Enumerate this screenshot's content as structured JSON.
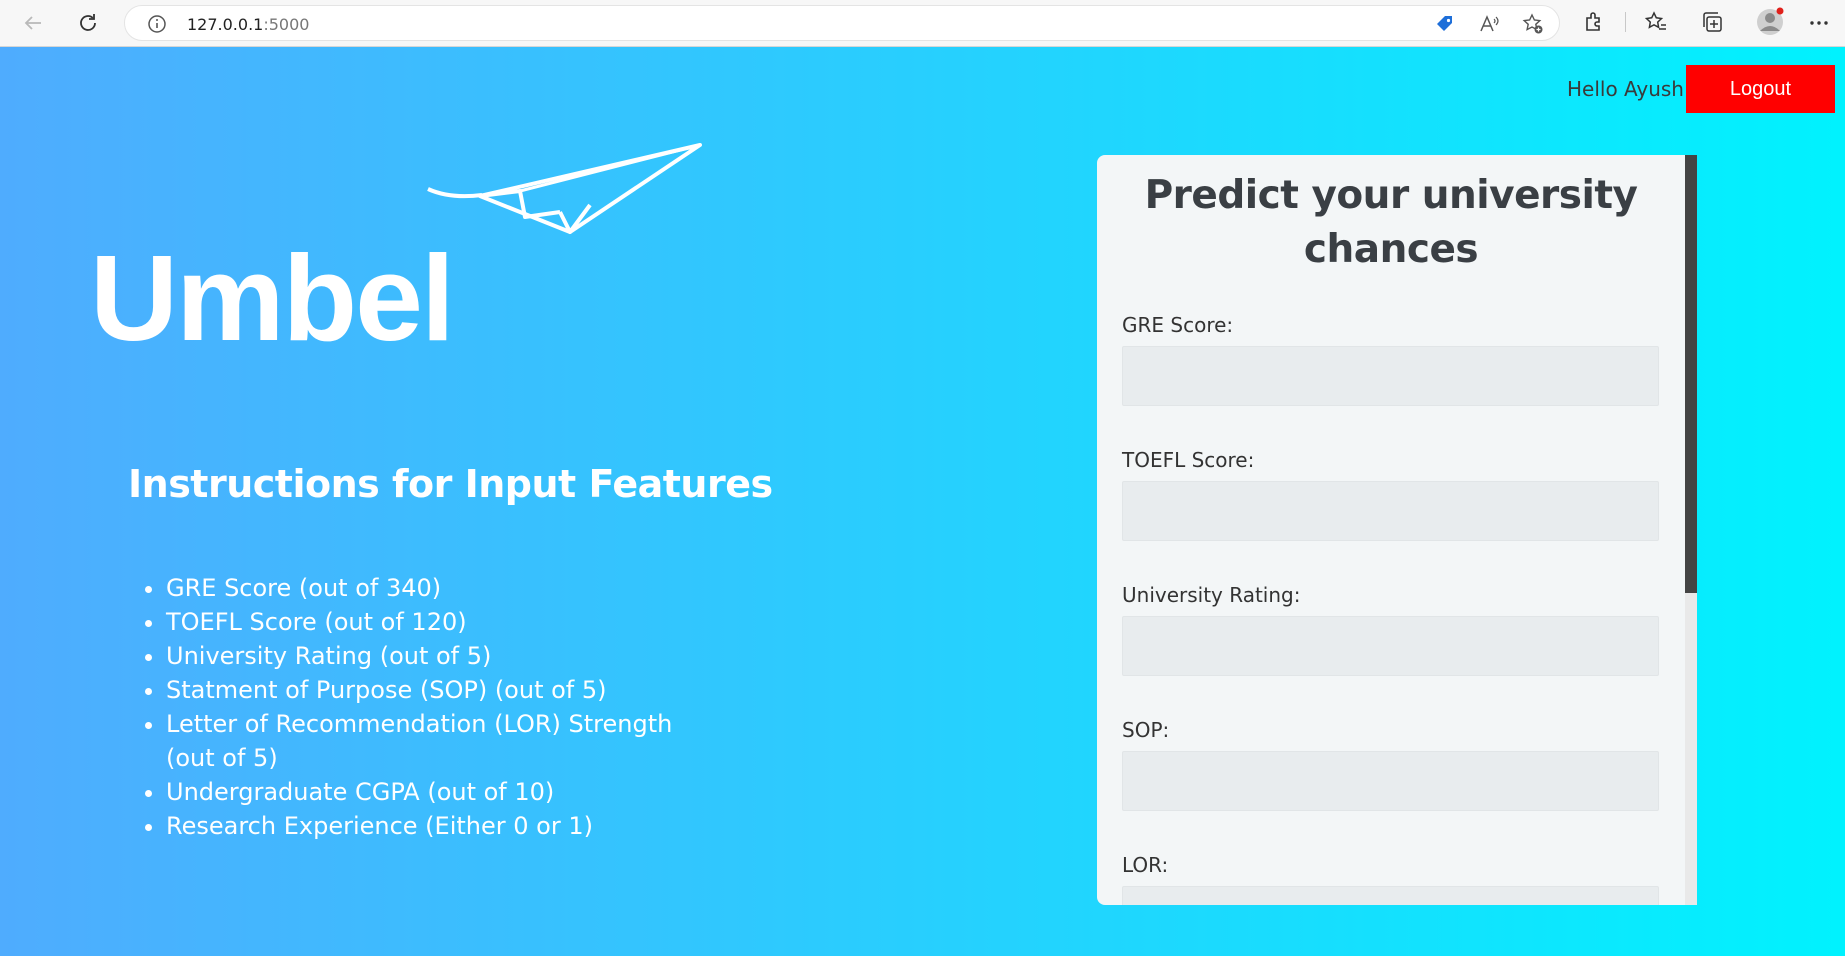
{
  "browser": {
    "url_host": "127.0.0.1",
    "url_port": ":5000"
  },
  "header": {
    "greeting": "Hello Ayush",
    "logout_label": "Logout"
  },
  "brand": {
    "logo_text": "Umbel"
  },
  "instructions": {
    "title": "Instructions for Input Features",
    "items": [
      "GRE Score (out of 340)",
      "TOEFL Score (out of 120)",
      "University Rating (out of 5)",
      "Statment of Purpose (SOP) (out of 5)",
      "Letter of Recommendation (LOR) Strength (out of 5)",
      "Undergraduate CGPA (out of 10)",
      "Research Experience (Either 0 or 1)"
    ]
  },
  "form": {
    "title": "Predict your university chances",
    "fields": [
      {
        "label": "GRE Score:",
        "value": ""
      },
      {
        "label": "TOEFL Score:",
        "value": ""
      },
      {
        "label": "University Rating:",
        "value": ""
      },
      {
        "label": "SOP:",
        "value": ""
      },
      {
        "label": "LOR:",
        "value": ""
      }
    ]
  },
  "colors": {
    "gradient_start": "#4facfe",
    "gradient_end": "#00f2fe",
    "logout_bg": "#ff0000"
  }
}
